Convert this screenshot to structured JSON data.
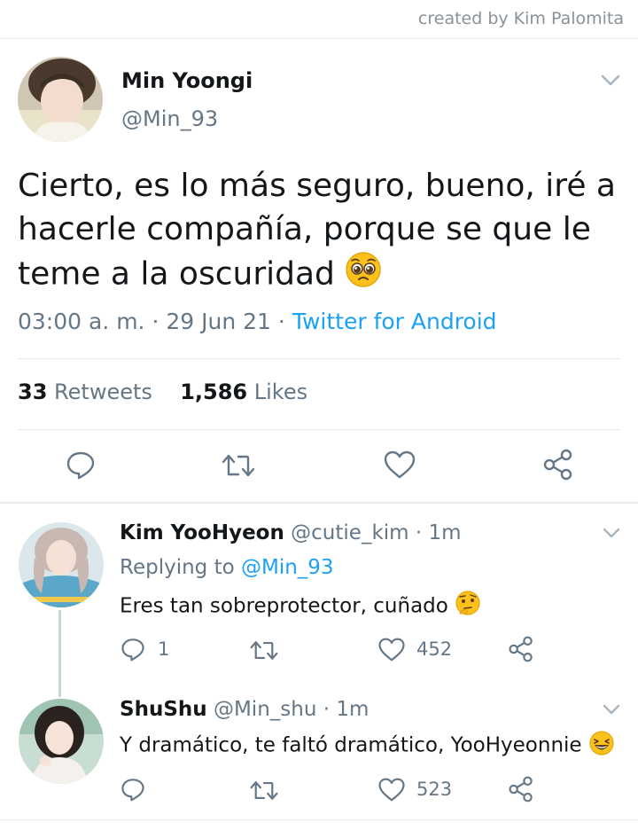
{
  "credit": "created by Kim Palomita",
  "main_tweet": {
    "author_name": "Min Yoongi",
    "author_handle": "@Min_93",
    "text": "Cierto, es lo más seguro, bueno, iré a hacerle compañía, porque se que le teme a la oscuridad",
    "text_emoji": "pleading-face-emoji",
    "time": "03:00 a. m.",
    "date": "29 Jun 21",
    "separator": "·",
    "source": "Twitter for Android",
    "retweets_count": "33",
    "retweets_label": "Retweets",
    "likes_count": "1,586",
    "likes_label": "Likes"
  },
  "replies": [
    {
      "author_name": "Kim YooHyeon",
      "author_handle": "@cutie_kim",
      "time": "1m",
      "replying_prefix": "Replying to",
      "replying_to": "@Min_93",
      "text": "Eres tan sobreprotector, cuñado",
      "emoji": "thinking-face-emoji",
      "reply_count": "1",
      "like_count": "452"
    },
    {
      "author_name": "ShuShu",
      "author_handle": "@Min_shu",
      "time": "1m",
      "text": "Y dramático, te faltó dramático, YooHyeonnie",
      "emoji": "laughing-face-emoji",
      "like_count": "523"
    }
  ],
  "colors": {
    "link": "#1da1f2",
    "secondary_text": "#657786",
    "icon": "#657786",
    "divider": "#e1e8ed"
  }
}
